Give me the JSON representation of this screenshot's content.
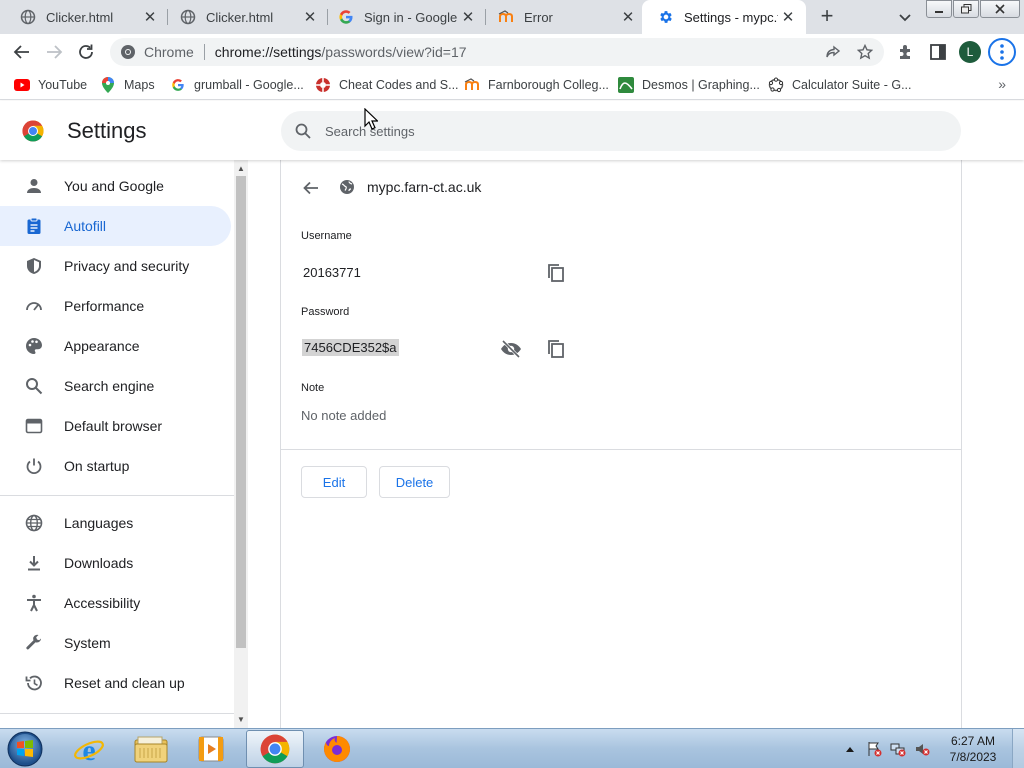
{
  "tabs": [
    {
      "title": "Clicker.html",
      "icon": "globe-icon",
      "active": false
    },
    {
      "title": "Clicker.html",
      "icon": "globe-icon",
      "active": false
    },
    {
      "title": "Sign in - Google A",
      "icon": "google-g-icon",
      "active": false
    },
    {
      "title": "Error",
      "icon": "moodle-icon",
      "active": false
    },
    {
      "title": "Settings - mypc.fa",
      "icon": "gear-icon",
      "active": true
    }
  ],
  "toolbar": {
    "omnibox_chip": "Chrome",
    "url_host": "chrome://settings",
    "url_path": "/passwords/view?id=17",
    "profile_initial": "L"
  },
  "bookmarks": [
    {
      "label": "YouTube",
      "icon": "youtube-icon"
    },
    {
      "label": "Maps",
      "icon": "maps-pin-icon"
    },
    {
      "label": "grumball - Google...",
      "icon": "google-g-icon"
    },
    {
      "label": "Cheat Codes and S...",
      "icon": "cheat-codes-icon"
    },
    {
      "label": "Farnborough Colleg...",
      "icon": "moodle-icon"
    },
    {
      "label": "Desmos | Graphing...",
      "icon": "desmos-icon"
    },
    {
      "label": "Calculator Suite - G...",
      "icon": "geogebra-icon"
    }
  ],
  "settings": {
    "title": "Settings",
    "search_placeholder": "Search settings"
  },
  "sidebar": {
    "items": [
      {
        "label": "You and Google",
        "icon": "person-icon",
        "active": false
      },
      {
        "label": "Autofill",
        "icon": "clipboard-icon",
        "active": true
      },
      {
        "label": "Privacy and security",
        "icon": "shield-icon",
        "active": false
      },
      {
        "label": "Performance",
        "icon": "speedometer-icon",
        "active": false
      },
      {
        "label": "Appearance",
        "icon": "palette-icon",
        "active": false
      },
      {
        "label": "Search engine",
        "icon": "search-icon",
        "active": false
      },
      {
        "label": "Default browser",
        "icon": "browser-window-icon",
        "active": false
      },
      {
        "label": "On startup",
        "icon": "power-icon",
        "active": false
      },
      {
        "label": "Languages",
        "icon": "globe-icon",
        "active": false
      },
      {
        "label": "Downloads",
        "icon": "download-icon",
        "active": false
      },
      {
        "label": "Accessibility",
        "icon": "accessibility-icon",
        "active": false
      },
      {
        "label": "System",
        "icon": "wrench-icon",
        "active": false
      },
      {
        "label": "Reset and clean up",
        "icon": "restore-icon",
        "active": false
      }
    ]
  },
  "password_entry": {
    "site": "mypc.farn-ct.ac.uk",
    "username_label": "Username",
    "username": "20163771",
    "password_label": "Password",
    "password": "7456CDE352$a",
    "note_label": "Note",
    "note": "No note added",
    "edit_label": "Edit",
    "delete_label": "Delete"
  },
  "taskbar": {
    "apps": [
      {
        "name": "internet-explorer"
      },
      {
        "name": "file-explorer"
      },
      {
        "name": "media-player"
      },
      {
        "name": "chrome",
        "active": true
      },
      {
        "name": "firefox"
      }
    ],
    "time": "6:27 AM",
    "date": "7/8/2023"
  },
  "colors": {
    "accent": "#1a73e8",
    "active_nav_bg": "#e8f0fe",
    "active_nav_text": "#1967d2",
    "tabstrip": "#dee1e6"
  }
}
